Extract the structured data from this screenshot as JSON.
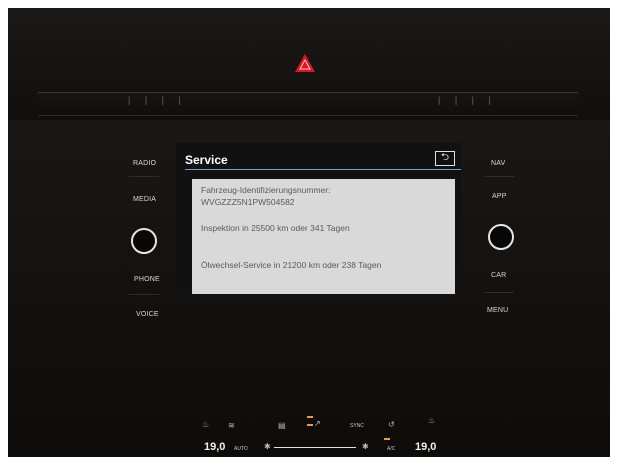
{
  "screen": {
    "title": "Service",
    "back_icon": "back-arrow-icon",
    "accent_color": "#6aa0e0"
  },
  "left_buttons": [
    "RADIO",
    "MEDIA",
    "PHONE",
    "VOICE"
  ],
  "right_buttons": [
    "NAV",
    "APP",
    "CAR",
    "MENU"
  ],
  "dialog": {
    "vin_label": "Fahrzeug-Identifizierungsnummer:",
    "vin_value": "WVGZZZ5N1PW504582",
    "inspection": "Inspektion in 25500 km oder 341 Tagen",
    "oil_service": "Ölwechsel-Service in 21200 km oder 238 Tagen"
  },
  "climate": {
    "left_temp": "19,0",
    "right_temp": "19,0",
    "auto_label": "AUTO",
    "sync_label": "SYNC",
    "ac_label": "A/C",
    "highlight_color": "#f0a020"
  },
  "hazard_color": "#e0141e"
}
